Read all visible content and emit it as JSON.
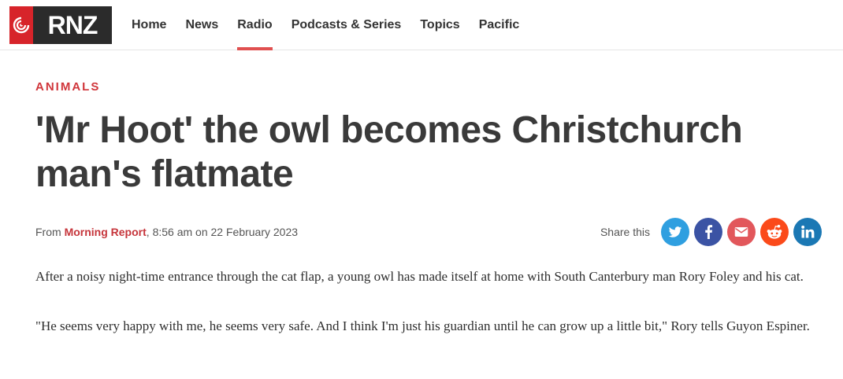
{
  "brand": {
    "logo_text": "RNZ"
  },
  "nav": {
    "items": [
      {
        "label": "Home"
      },
      {
        "label": "News"
      },
      {
        "label": "Radio"
      },
      {
        "label": "Podcasts & Series"
      },
      {
        "label": "Topics"
      },
      {
        "label": "Pacific"
      }
    ],
    "active": "Radio"
  },
  "article": {
    "section": "ANIMALS",
    "headline": "'Mr Hoot' the owl becomes Christchurch man's flatmate",
    "byline": {
      "prefix": "From ",
      "source": "Morning Report",
      "time": "8:56 am",
      "on": " on ",
      "date": "22 February 2023"
    },
    "paragraphs": [
      "After a noisy night-time entrance through the cat flap, a young owl has made itself at home with South Canterbury man Rory Foley and his cat.",
      "\"He seems very happy with me, he seems very safe. And I think I'm just his guardian until he can grow up a little bit,\" Rory tells Guyon Espiner."
    ]
  },
  "share": {
    "label": "Share this",
    "buttons": [
      {
        "icon": "twitter-icon",
        "color": "#2f9fe0"
      },
      {
        "icon": "facebook-icon",
        "color": "#3b53a4"
      },
      {
        "icon": "email-icon",
        "color": "#e2575b"
      },
      {
        "icon": "reddit-icon",
        "color": "#fb4a1a"
      },
      {
        "icon": "linkedin-icon",
        "color": "#1b78b4"
      }
    ]
  },
  "colors": {
    "accent": "#d0353a",
    "nav_active_underline": "#e05050"
  }
}
